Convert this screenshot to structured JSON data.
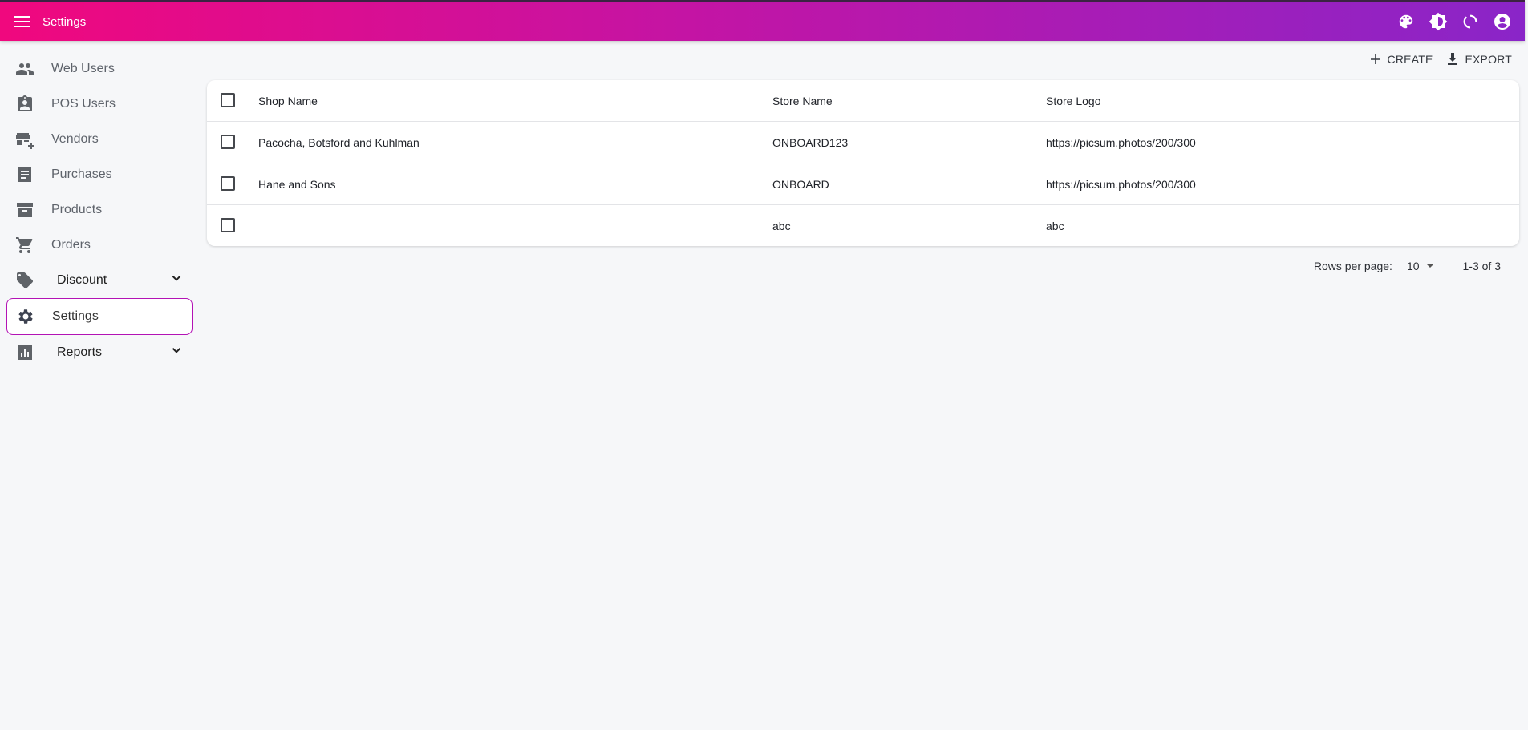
{
  "appbar": {
    "title": "Settings",
    "icons": [
      "menu-icon",
      "palette-icon",
      "brightness-icon",
      "refresh-icon",
      "account-icon"
    ]
  },
  "sidebar": {
    "items": [
      {
        "label": "Web Users",
        "icon": "people-icon"
      },
      {
        "label": "POS Users",
        "icon": "badge-icon"
      },
      {
        "label": "Vendors",
        "icon": "store-add-icon"
      },
      {
        "label": "Purchases",
        "icon": "list-icon"
      },
      {
        "label": "Products",
        "icon": "archive-icon"
      },
      {
        "label": "Orders",
        "icon": "cart-icon"
      },
      {
        "label": "Discount",
        "icon": "tag-icon",
        "expandable": true
      },
      {
        "label": "Settings",
        "icon": "gear-icon",
        "active": true
      },
      {
        "label": "Reports",
        "icon": "bar-chart-icon",
        "expandable": true
      }
    ]
  },
  "toolbar": {
    "create_label": "CREATE",
    "export_label": "EXPORT"
  },
  "table": {
    "columns": [
      "Shop Name",
      "Store Name",
      "Store Logo"
    ],
    "rows": [
      [
        "Pacocha, Botsford and Kuhlman",
        "ONBOARD123",
        "https://picsum.photos/200/300"
      ],
      [
        "Hane and Sons",
        "ONBOARD",
        "https://picsum.photos/200/300"
      ],
      [
        "",
        "abc",
        "abc"
      ]
    ]
  },
  "pagination": {
    "rows_per_page_label": "Rows per page:",
    "rows_per_page_value": "10",
    "range": "1-3 of 3"
  },
  "colors": {
    "appbar_start": "#f0087e",
    "appbar_end": "#8a25c8",
    "active_outline": "#b313b5"
  }
}
